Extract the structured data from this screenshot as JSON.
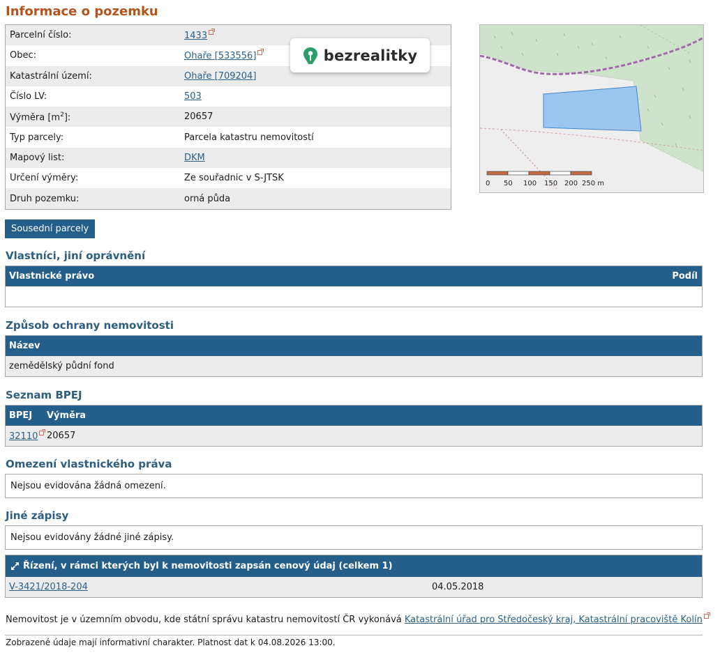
{
  "page_title": "Informace o pozemku",
  "logo": {
    "text": "bezrealitky",
    "accent": "#2a9d6b"
  },
  "info_rows": [
    {
      "label": "Parcelní číslo:",
      "value": "1433",
      "link": true,
      "ext": true
    },
    {
      "label": "Obec:",
      "value": "Ohaře [533556]",
      "link": true,
      "ext": true
    },
    {
      "label": "Katastrální území:",
      "value": "Ohaře [709204]",
      "link": true,
      "ext": false
    },
    {
      "label": "Číslo LV:",
      "value": "503",
      "link": true,
      "ext": false
    },
    {
      "label_main": "Výměra [m",
      "label_sup": "2",
      "label_end": "]:",
      "value": "20657",
      "link": false,
      "ext": false
    },
    {
      "label": "Typ parcely:",
      "value": "Parcela katastru nemovitostí",
      "link": false,
      "ext": false
    },
    {
      "label": "Mapový list:",
      "value": "DKM",
      "link": true,
      "ext": false
    },
    {
      "label": "Určení výměry:",
      "value": "Ze souřadnic v S-JTSK",
      "link": false,
      "ext": false
    },
    {
      "label": "Druh pozemku:",
      "value": "orná půda",
      "link": false,
      "ext": false
    }
  ],
  "map": {
    "scale_labels": [
      "0",
      "50",
      "100",
      "150",
      "200",
      "250 m"
    ]
  },
  "neighbor_button": "Sousední parcely",
  "owners": {
    "heading": "Vlastníci, jiní oprávnění",
    "col_left": "Vlastnické právo",
    "col_right": "Podíl"
  },
  "protection": {
    "heading": "Způsob ochrany nemovitosti",
    "col": "Název",
    "value": "zemědělský půdní fond"
  },
  "bpej": {
    "heading": "Seznam BPEJ",
    "col1": "BPEJ",
    "col2": "Výměra",
    "code": "32110",
    "area": "20657"
  },
  "restrictions": {
    "heading": "Omezení vlastnického práva",
    "text": "Nejsou evidována žádná omezení."
  },
  "other_records": {
    "heading": "Jiné zápisy",
    "text": "Nejsou evidovány žádné jiné zápisy."
  },
  "proceedings": {
    "header": "Řízení, v rámci kterých byl k nemovitosti zapsán cenový údaj (celkem 1)",
    "id": "V-3421/2018-204",
    "date": "04.05.2018"
  },
  "footer": {
    "text_prefix": "Nemovitost je v územním obvodu, kde státní správu katastru nemovitostí ČR vykonává ",
    "link": "Katastrální úřad pro Středočeský kraj, Katastrální pracoviště Kolín",
    "disclaimer": "Zobrazené údaje mají informativní charakter. Platnost dat k 04.08.2026 13:00."
  }
}
